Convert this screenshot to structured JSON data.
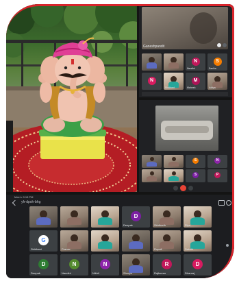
{
  "colors": {
    "frame_accent": "#d8252c",
    "meet_background": "#202124",
    "tile_background": "#3c4043",
    "leave_call": "#ea4335"
  },
  "top_panel": {
    "speaker_label": "Ganeshpandit",
    "row": [
      {
        "letter": "",
        "color": "",
        "name": ""
      },
      {
        "letter": "",
        "color": "",
        "name": ""
      },
      {
        "letter": "N",
        "color": "#c2185b",
        "name": "Nandini"
      },
      {
        "letter": "S",
        "color": "#f57c00",
        "name": "Sanika"
      },
      {
        "letter": "N",
        "color": "#d81b60",
        "name": ""
      },
      {
        "letter": "",
        "color": "",
        "name": "Siddhant"
      },
      {
        "letter": "M",
        "color": "#ad1457",
        "name": "Mahesh"
      },
      {
        "letter": "",
        "color": "",
        "name": "Aditya"
      }
    ]
  },
  "middle_panel": {
    "tiles": [
      {
        "letter": "",
        "color": ""
      },
      {
        "letter": "",
        "color": ""
      },
      {
        "letter": "S",
        "color": "#f57c00"
      },
      {
        "letter": "N",
        "color": "#8e24aa"
      },
      {
        "letter": "",
        "color": ""
      },
      {
        "letter": "",
        "color": ""
      },
      {
        "letter": "S",
        "color": "#7b1fa2"
      },
      {
        "letter": "P",
        "color": "#c2185b"
      }
    ]
  },
  "bottom_panel": {
    "status_left": "Meet • 9:15 PM",
    "meeting_code": "yfr-dpoh-bhg",
    "row1": [
      {
        "letter": "",
        "color": "",
        "name": ""
      },
      {
        "letter": "",
        "color": "",
        "name": ""
      },
      {
        "letter": "",
        "color": "",
        "name": ""
      },
      {
        "letter": "D",
        "color": "#7b1fa2",
        "name": "Deepak"
      },
      {
        "letter": "",
        "color": "",
        "name": "Siddharth"
      },
      {
        "letter": "",
        "color": "",
        "name": "Riya"
      }
    ],
    "row2": [
      {
        "letter": "G",
        "color": "#ffffff",
        "name": "Siddhant"
      },
      {
        "letter": "",
        "color": "",
        "name": "Pranav"
      },
      {
        "letter": "",
        "color": "",
        "name": ""
      },
      {
        "letter": "",
        "color": "",
        "name": ""
      },
      {
        "letter": "",
        "color": "",
        "name": "Rupali"
      },
      {
        "letter": "",
        "color": "",
        "name": "Sakshi"
      }
    ],
    "row3": [
      {
        "letter": "D",
        "color": "#2e7d32",
        "name": "Deepak"
      },
      {
        "letter": "N",
        "color": "#558b2f",
        "name": "Nandini"
      },
      {
        "letter": "N",
        "color": "#8e24aa",
        "name": "Nikhil"
      },
      {
        "letter": "",
        "color": "",
        "name": "Shreya"
      },
      {
        "letter": "R",
        "color": "#c2185b",
        "name": "Rajkumar"
      },
      {
        "letter": "D",
        "color": "#d81b60",
        "name": "Dhanraj"
      }
    ]
  }
}
